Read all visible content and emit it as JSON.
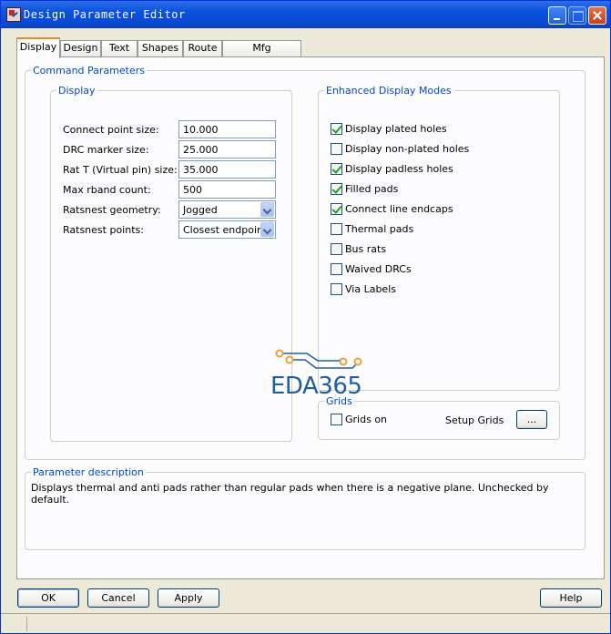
{
  "window": {
    "title": "Design Parameter Editor"
  },
  "tabs": [
    "Display",
    "Design",
    "Text",
    "Shapes",
    "Route",
    "Mfg Applications"
  ],
  "command_parameters": {
    "legend": "Command Parameters",
    "display": {
      "legend": "Display",
      "fields": [
        {
          "label": "Connect point size:",
          "value": "10.000"
        },
        {
          "label": "DRC marker size:",
          "value": "25.000"
        },
        {
          "label": "Rat T (Virtual pin) size:",
          "value": "35.000"
        },
        {
          "label": "Max rband count:",
          "value": "500"
        },
        {
          "label": "Ratsnest geometry:",
          "value": "Jogged"
        },
        {
          "label": "Ratsnest points:",
          "value": "Closest endpoint"
        }
      ]
    },
    "enhanced": {
      "legend": "Enhanced Display Modes",
      "items": [
        {
          "label": "Display plated holes",
          "checked": true
        },
        {
          "label": "Display non-plated holes",
          "checked": false
        },
        {
          "label": "Display padless holes",
          "checked": true
        },
        {
          "label": "Filled pads",
          "checked": true
        },
        {
          "label": "Connect line endcaps",
          "checked": true
        },
        {
          "label": "Thermal pads",
          "checked": false
        },
        {
          "label": "Bus rats",
          "checked": false
        },
        {
          "label": "Waived DRCs",
          "checked": false
        },
        {
          "label": "Via Labels",
          "checked": false
        }
      ]
    },
    "grids": {
      "legend": "Grids",
      "grids_on_label": "Grids on",
      "grids_on_checked": false,
      "setup_label": "Setup Grids",
      "button": "..."
    }
  },
  "description": {
    "legend": "Parameter description",
    "text": "Displays thermal and anti pads rather than regular pads when there is a negative plane. Unchecked by default."
  },
  "buttons": {
    "ok": "OK",
    "cancel": "Cancel",
    "apply": "Apply",
    "help": "Help"
  },
  "watermark": {
    "text": "EDA365"
  }
}
